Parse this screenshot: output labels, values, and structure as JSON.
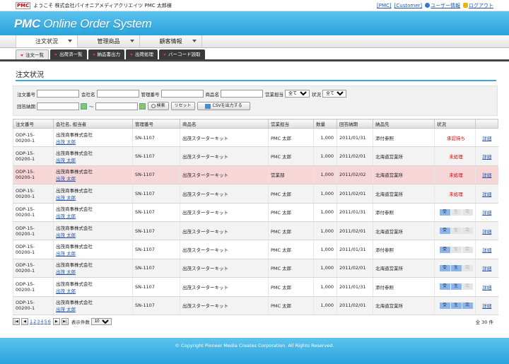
{
  "topbar": {
    "logo": "PMC",
    "welcome": "ようこそ 株式会社パイオニアメディアクリエイツ PMC 太郎様",
    "links": [
      "[PMC]",
      "[Customer]",
      "ユーザー情報",
      "ログアウト"
    ]
  },
  "banner": {
    "brand": "PMC",
    "title": " Online Order System"
  },
  "nav": {
    "main": [
      "注文状況",
      "管理商品",
      "顧客情報"
    ],
    "sub": [
      "注文一覧",
      "出荷済一覧",
      "納品書出力",
      "出荷処理",
      "バーコード読取"
    ]
  },
  "page_title": "注文状況",
  "search": {
    "labels": {
      "order_no": "注文番号",
      "company": "会社名",
      "mgmt_no": "管理番号",
      "product": "商品名",
      "sales": "営業担当",
      "status": "状況",
      "delivery": "回答納期",
      "tilde": "～"
    },
    "sales_value": "全て",
    "status_value": "全て",
    "buttons": {
      "search": "検索",
      "reset": "リセット",
      "csv": "CSVを出力する"
    }
  },
  "table": {
    "headers": [
      "注文番号",
      "会社名, 担当者",
      "管理番号",
      "商品名",
      "営業担当",
      "数量",
      "回答納期",
      "納品先",
      "状況",
      ""
    ],
    "rows": [
      {
        "order1": "ODP-15-",
        "order2": "00200-1",
        "company": "出茂商事株式会社",
        "person": "出茂 太郎",
        "mgmt": "SN-1107",
        "product": "出茂スターターキット",
        "sales": "PMC 太郎",
        "qty": "1,000",
        "date": "2011/01/31",
        "dest": "添付参照",
        "status": "承認待ち",
        "detail": "詳細"
      },
      {
        "order1": "ODP-15-",
        "order2": "00200-1",
        "company": "出茂商事株式会社",
        "person": "出茂 太郎",
        "mgmt": "SN-1107",
        "product": "出茂スターターキット",
        "sales": "PMC 太郎",
        "qty": "1,000",
        "date": "2011/02/01",
        "dest": "北海道営業所",
        "status": "未処理",
        "detail": "詳細"
      },
      {
        "order1": "ODP-15-",
        "order2": "00200-1",
        "company": "出茂商事株式会社",
        "person": "出茂 太郎",
        "mgmt": "SN-1107",
        "product": "出茂スターターキット",
        "sales": "営業部",
        "qty": "1,000",
        "date": "2011/02/02",
        "dest": "北海道営業所",
        "status": "未処理",
        "detail": "詳細"
      },
      {
        "order1": "ODP-15-",
        "order2": "00200-1",
        "company": "出茂商事株式会社",
        "person": "出茂 太郎",
        "mgmt": "SN-1107",
        "product": "出茂スターターキット",
        "sales": "PMC 太郎",
        "qty": "1,000",
        "date": "2011/02/01",
        "dest": "北海道営業所",
        "status": "未処理",
        "detail": "詳細"
      },
      {
        "order1": "ODP-15-",
        "order2": "00200-1",
        "company": "出茂商事株式会社",
        "person": "出茂 太郎",
        "mgmt": "SN-1107",
        "product": "出茂スターターキット",
        "sales": "PMC 太郎",
        "qty": "1,000",
        "date": "2011/01/31",
        "dest": "添付参照",
        "stamps": 1,
        "detail": "詳細"
      },
      {
        "order1": "ODP-15-",
        "order2": "00200-1",
        "company": "出茂商事株式会社",
        "person": "出茂 太郎",
        "mgmt": "SN-1107",
        "product": "出茂スターターキット",
        "sales": "PMC 太郎",
        "qty": "1,000",
        "date": "2011/02/01",
        "dest": "北海道営業所",
        "stamps": 1,
        "detail": "詳細"
      },
      {
        "order1": "ODP-15-",
        "order2": "00200-1",
        "company": "出茂商事株式会社",
        "person": "出茂 太郎",
        "mgmt": "SN-1107",
        "product": "出茂スターターキット",
        "sales": "PMC 太郎",
        "qty": "1,000",
        "date": "2011/01/31",
        "dest": "添付参照",
        "stamps": 1,
        "detail": "詳細"
      },
      {
        "order1": "ODP-15-",
        "order2": "00200-1",
        "company": "出茂商事株式会社",
        "person": "出茂 太郎",
        "mgmt": "SN-1107",
        "product": "出茂スターターキット",
        "sales": "PMC 太郎",
        "qty": "1,000",
        "date": "2011/02/01",
        "dest": "北海道営業所",
        "stamps": 2,
        "detail": "詳細"
      },
      {
        "order1": "ODP-15-",
        "order2": "00200-1",
        "company": "出茂商事株式会社",
        "person": "出茂 太郎",
        "mgmt": "SN-1107",
        "product": "出茂スターターキット",
        "sales": "PMC 太郎",
        "qty": "1,000",
        "date": "2011/01/31",
        "dest": "添付参照",
        "stamps": 2,
        "detail": "詳細"
      },
      {
        "order1": "ODP-15-",
        "order2": "00200-1",
        "company": "出茂商事株式会社",
        "person": "出茂 太郎",
        "mgmt": "SN-1107",
        "product": "出茂スターターキット",
        "sales": "PMC 太郎",
        "qty": "1,000",
        "date": "2011/02/01",
        "dest": "北海道営業所",
        "stamps": 3,
        "detail": "詳細"
      }
    ],
    "stamp_labels": [
      "受",
      "生",
      "完"
    ],
    "highlight_row": 2
  },
  "pager": {
    "pages": [
      "1",
      "2",
      "3",
      "4",
      "5",
      "6"
    ],
    "per_page_label": "表示件数",
    "per_page": "10",
    "total": "全 30 件"
  },
  "footer": "© Copyright Pioneer Media Creates Corporation. All Rights Reserved."
}
